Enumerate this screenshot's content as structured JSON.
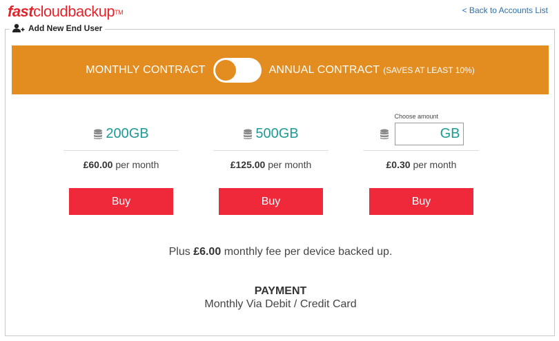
{
  "header": {
    "logo_fast": "fast",
    "logo_rest": "cloudbackup",
    "logo_tm": "TM",
    "back_link": "< Back to Accounts List"
  },
  "section": {
    "title": "Add New End User"
  },
  "contract": {
    "monthly_label": "MONTHLY CONTRACT",
    "annual_label": "ANNUAL CONTRACT",
    "annual_note": "(SAVES AT LEAST 10%)"
  },
  "plans": [
    {
      "size": "200GB",
      "price": "£60.00",
      "per": "per month",
      "buy": "Buy"
    },
    {
      "size": "500GB",
      "price": "£125.00",
      "per": "per month",
      "buy": "Buy"
    },
    {
      "amount_label": "Choose amount",
      "unit": "GB",
      "price": "£0.30",
      "per": "per month",
      "buy": "Buy"
    }
  ],
  "fee": {
    "prefix": "Plus",
    "amount": "£6.00",
    "suffix": "monthly fee per device backed up."
  },
  "payment": {
    "title": "PAYMENT",
    "method": "Monthly Via Debit / Credit Card"
  },
  "colors": {
    "brand_red": "#e3242b",
    "banner_orange": "#e38c1f",
    "buy_red": "#f0293a",
    "teal": "#1d9a94"
  }
}
